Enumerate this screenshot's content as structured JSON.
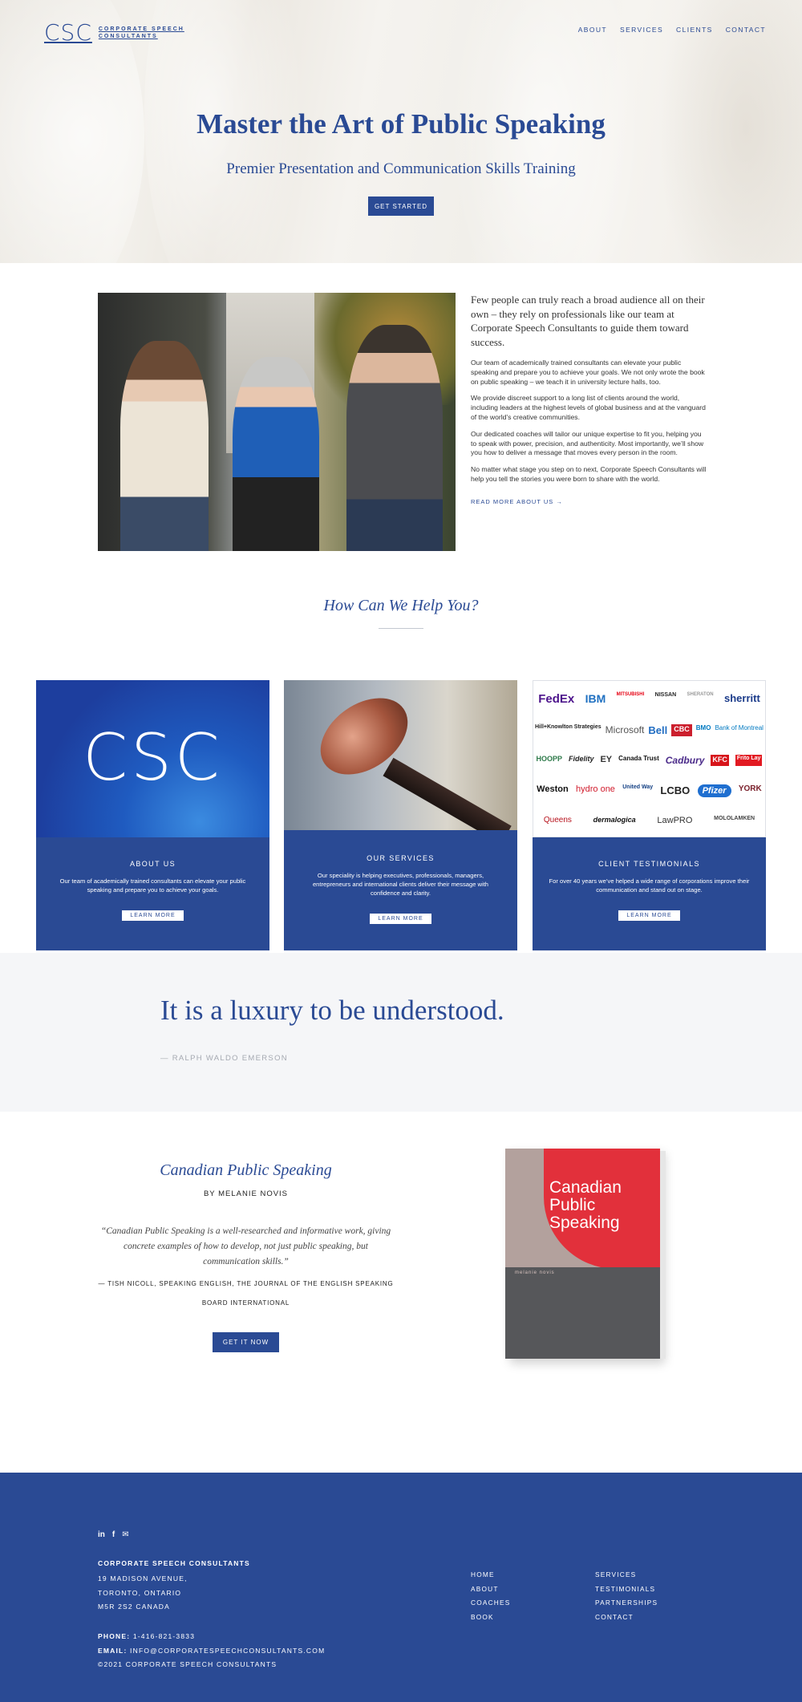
{
  "header": {
    "logo_mark": "CSC",
    "logo_line1": "CORPORATE SPEECH",
    "logo_line2": "CONSULTANTS",
    "nav": [
      "ABOUT",
      "SERVICES",
      "CLIENTS",
      "CONTACT"
    ]
  },
  "hero": {
    "title": "Master the Art of Public Speaking",
    "subtitle": "Premier Presentation and Communication Skills Training",
    "cta": "GET STARTED"
  },
  "intro": {
    "lead": "Few people can truly reach a broad audience all on their own – they rely on professionals like our team at Corporate Speech Consultants to guide them toward success.",
    "paragraphs": [
      "Our team of academically trained consultants can elevate your public speaking and prepare you to achieve your goals. We not only wrote the book on public speaking – we teach it in university lecture halls, too.",
      "We provide discreet support to a long list of clients around the world, including leaders at the highest levels of global business and at the vanguard of the world’s creative communities.",
      "Our dedicated coaches will tailor our unique expertise to fit you, helping you to speak with power, precision, and authenticity. Most importantly, we’ll show you how to deliver a message that moves every person in the room.",
      "No matter what stage you step on to next, Corporate Speech Consultants will help you tell the stories you were born to share with the world."
    ],
    "read_more": "READ MORE ABOUT US →"
  },
  "help": {
    "heading": "How Can We Help You?"
  },
  "cards": [
    {
      "image_text": "CSC",
      "title": "ABOUT US",
      "desc": "Our team of academically trained consultants can elevate your public speaking and prepare you to achieve your goals.",
      "button": "LEARN MORE"
    },
    {
      "title": "OUR SERVICES",
      "desc": "Our speciality is helping executives, professionals, managers, entrepreneurs and international clients deliver their message with confidence and clarity.",
      "button": "LEARN MORE"
    },
    {
      "title": "CLIENT TESTIMONIALS",
      "desc": "For over 40 years we’ve helped a wide range of corporations improve their communication and stand out on stage.",
      "button": "LEARN MORE",
      "logos": [
        "FedEx",
        "IBM",
        "MITSUBISHI",
        "NISSAN",
        "SHERATON",
        "sherritt",
        "Hill+Knowlton Strategies",
        "Microsoft",
        "Bell",
        "CBC",
        "BMO",
        "Bank of Montreal",
        "HOOPP",
        "Fidelity",
        "EY",
        "Canada Trust",
        "Cadbury",
        "KFC",
        "Frito Lay",
        "Weston",
        "hydro one",
        "United Way",
        "LCBO",
        "Pfizer",
        "YORK",
        "Queens",
        "dermalogica",
        "LawPRO",
        "MOLOLAMKEN"
      ]
    }
  ],
  "quote": {
    "text": "It is a luxury to be understood.",
    "author": "— RALPH WALDO EMERSON"
  },
  "book": {
    "title": "Canadian Public Speaking",
    "author": "BY MELANIE NOVIS",
    "quote": "“Canadian Public Speaking is a well-researched and informative work, giving concrete examples of how to develop, not just public speaking, but communication skills.”",
    "source": "— TISH NICOLL, SPEAKING ENGLISH, THE JOURNAL OF THE ENGLISH SPEAKING BOARD INTERNATIONAL",
    "cta": "GET IT NOW",
    "cover_title_1": "Canadian",
    "cover_title_2": "Public",
    "cover_title_3": "Speaking",
    "cover_author": "melanie novis"
  },
  "footer": {
    "company": "CORPORATE SPEECH CONSULTANTS",
    "address_1": "19 MADISON AVENUE,",
    "address_2": "TORONTO, ONTARIO",
    "address_3": "M5R 2S2 CANADA",
    "phone_label": "PHONE:",
    "phone": "1-416-821-3833",
    "email_label": "EMAIL:",
    "email": "INFO@CORPORATESPEECHCONSULTANTS.COM",
    "copyright": "©2021 CORPORATE SPEECH CONSULTANTS",
    "links_col1": [
      "HOME",
      "ABOUT",
      "COACHES",
      "BOOK"
    ],
    "links_col2": [
      "SERVICES",
      "TESTIMONIALS",
      "PARTNERSHIPS",
      "CONTACT"
    ]
  },
  "colors": {
    "brand_blue": "#2a4a94",
    "quote_bg": "#f5f6f8",
    "cover_red": "#e2303b"
  }
}
